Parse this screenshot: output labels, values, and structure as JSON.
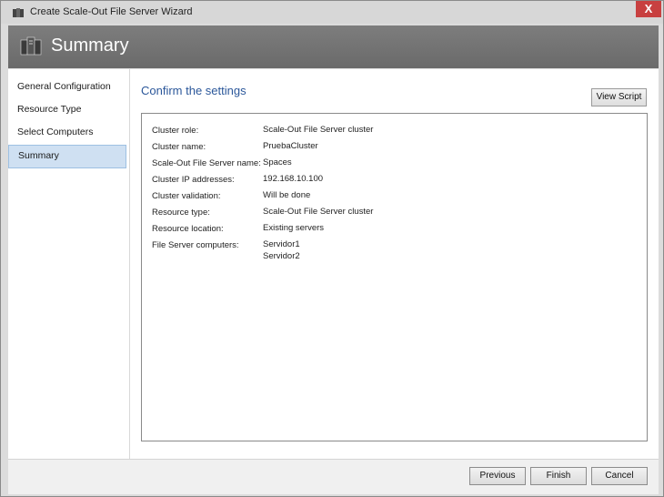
{
  "window": {
    "title": "Create Scale-Out File Server Wizard",
    "close_label": "X"
  },
  "header": {
    "title": "Summary"
  },
  "sidebar": {
    "items": [
      {
        "label": "General Configuration"
      },
      {
        "label": "Resource Type"
      },
      {
        "label": "Select Computers"
      },
      {
        "label": "Summary",
        "selected": true
      }
    ]
  },
  "main": {
    "heading": "Confirm the settings",
    "view_script_label": "View Script",
    "settings": [
      {
        "label": "Cluster role:",
        "value": "Scale-Out File Server cluster"
      },
      {
        "label": "Cluster name:",
        "value": "PruebaCluster"
      },
      {
        "label": "Scale-Out File Server name:",
        "value": "Spaces"
      },
      {
        "label": "Cluster IP addresses:",
        "value": "192.168.10.100"
      },
      {
        "label": "Cluster validation:",
        "value": "Will be done"
      },
      {
        "label": "Resource type:",
        "value": "Scale-Out File Server cluster"
      },
      {
        "label": "Resource location:",
        "value": "Existing servers"
      },
      {
        "label": "File Server computers:",
        "value": "Servidor1",
        "value2": "Servidor2"
      }
    ]
  },
  "footer": {
    "previous_label": "Previous",
    "finish_label": "Finish",
    "cancel_label": "Cancel"
  },
  "colors": {
    "accent": "#2b579a",
    "header_bg": "#737373",
    "selected_bg": "#cfe0f2",
    "close_bg": "#c84040"
  },
  "icons": {
    "app": "server-cluster-icon",
    "header": "server-cluster-icon",
    "close": "close-icon"
  }
}
